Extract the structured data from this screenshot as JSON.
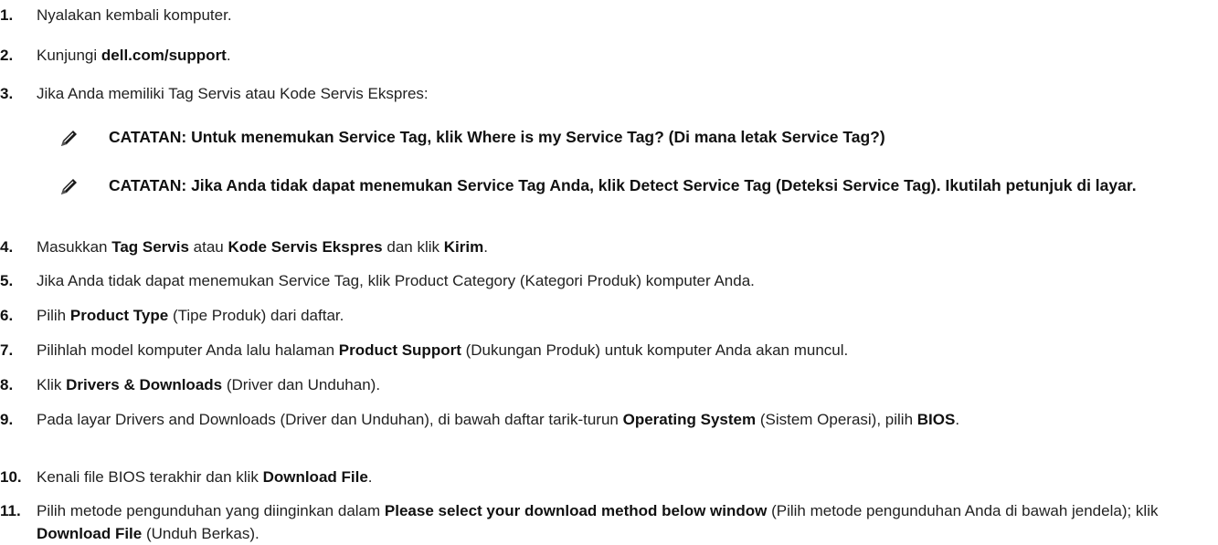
{
  "steps": [
    {
      "num": "1.",
      "parts": [
        {
          "t": "Nyalakan kembali komputer."
        }
      ]
    },
    {
      "num": "2.",
      "parts": [
        {
          "t": "Kunjungi "
        },
        {
          "b": "dell.com/support"
        },
        {
          "t": "."
        }
      ]
    },
    {
      "num": "3.",
      "parts": [
        {
          "t": "Jika Anda memiliki Tag Servis atau Kode Servis Ekspres:"
        }
      ]
    },
    {
      "num": "4.",
      "parts": [
        {
          "t": "Masukkan "
        },
        {
          "b": "Tag Servis"
        },
        {
          "t": " atau "
        },
        {
          "b": "Kode Servis Ekspres"
        },
        {
          "t": " dan klik "
        },
        {
          "b": "Kirim"
        },
        {
          "t": "."
        }
      ]
    },
    {
      "num": "5.",
      "parts": [
        {
          "t": "Jika Anda tidak dapat menemukan Service Tag, klik Product Category (Kategori Produk) komputer Anda."
        }
      ]
    },
    {
      "num": "6.",
      "parts": [
        {
          "t": "Pilih "
        },
        {
          "b": "Product Type"
        },
        {
          "t": " (Tipe Produk) dari daftar."
        }
      ]
    },
    {
      "num": "7.",
      "parts": [
        {
          "t": "Pilihlah model komputer Anda lalu halaman "
        },
        {
          "b": "Product Support"
        },
        {
          "t": " (Dukungan Produk) untuk komputer Anda akan muncul."
        }
      ]
    },
    {
      "num": "8.",
      "parts": [
        {
          "t": "Klik "
        },
        {
          "b": "Drivers & Downloads"
        },
        {
          "t": " (Driver dan Unduhan)."
        }
      ]
    },
    {
      "num": "9.",
      "parts": [
        {
          "t": "Pada layar Drivers and Downloads (Driver dan Unduhan), di bawah daftar tarik-turun "
        },
        {
          "b": "Operating System"
        },
        {
          "t": " (Sistem Operasi), pilih "
        },
        {
          "b": "BIOS"
        },
        {
          "t": "."
        }
      ]
    },
    {
      "num": "10.",
      "parts": [
        {
          "t": "Kenali file BIOS terakhir dan klik "
        },
        {
          "b": "Download File"
        },
        {
          "t": "."
        }
      ]
    },
    {
      "num": "11.",
      "parts": [
        {
          "t": "Pilih metode pengunduhan yang diinginkan dalam "
        },
        {
          "b": "Please select your download method below window"
        },
        {
          "t": " (Pilih metode pengunduhan Anda di bawah jendela); klik "
        },
        {
          "b": "Download File"
        },
        {
          "t": " (Unduh Berkas)."
        }
      ]
    }
  ],
  "notes": [
    {
      "text": "CATATAN: Untuk menemukan Service Tag, klik Where is my Service Tag? (Di mana letak Service Tag?)",
      "icon": "pencil-note-icon"
    },
    {
      "text": "CATATAN: Jika Anda tidak dapat menemukan Service Tag Anda, klik Detect Service Tag (Deteksi Service Tag). Ikutilah petunjuk di layar.",
      "icon": "pencil-note-icon"
    }
  ]
}
